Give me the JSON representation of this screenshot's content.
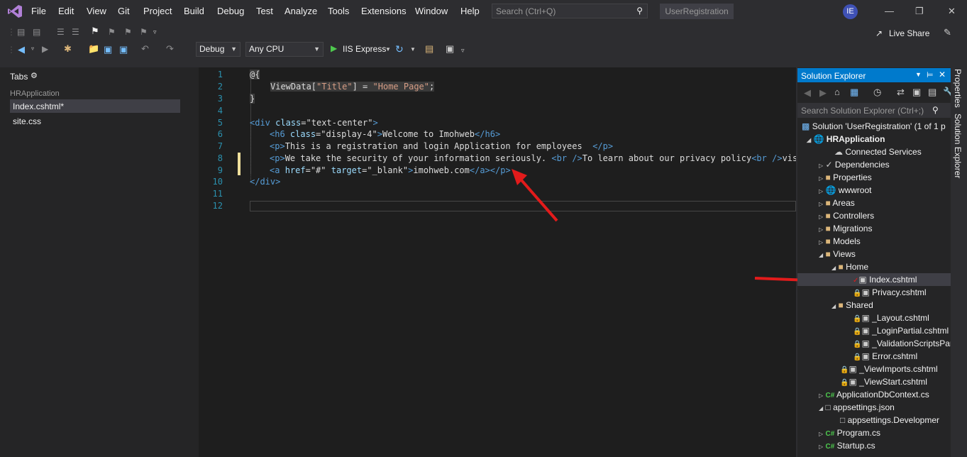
{
  "menu": [
    "File",
    "Edit",
    "View",
    "Git",
    "Project",
    "Build",
    "Debug",
    "Test",
    "Analyze",
    "Tools",
    "Extensions",
    "Window",
    "Help"
  ],
  "search": {
    "placeholder": "Search (Ctrl+Q)"
  },
  "solution_name": "UserRegistration",
  "user_initials": "IE",
  "live_share": "Live Share",
  "toolbar": {
    "config": "Debug",
    "platform": "Any CPU",
    "run_label": "IIS Express"
  },
  "tabs_panel": {
    "title": "Tabs",
    "group": "HRApplication",
    "files": [
      "Index.cshtml*",
      "site.css"
    ]
  },
  "editor": {
    "line_numbers": [
      "1",
      "2",
      "3",
      "4",
      "5",
      "6",
      "7",
      "8",
      "9",
      "10",
      "11",
      "12"
    ]
  },
  "solution_explorer": {
    "title": "Solution Explorer",
    "search_placeholder": "Search Solution Explorer (Ctrl+;)",
    "items": [
      "Solution 'UserRegistration' (1 of 1 p",
      "HRApplication",
      "Connected Services",
      "Dependencies",
      "Properties",
      "wwwroot",
      "Areas",
      "Controllers",
      "Migrations",
      "Models",
      "Views",
      "Home",
      "Index.cshtml",
      "Privacy.cshtml",
      "Shared",
      "_Layout.cshtml",
      "_LoginPartial.cshtml",
      "_ValidationScriptsPar",
      "Error.cshtml",
      "_ViewImports.cshtml",
      "_ViewStart.cshtml",
      "ApplicationDbContext.cs",
      "appsettings.json",
      "appsettings.Developmer",
      "Program.cs",
      "Startup.cs"
    ]
  },
  "side_tabs": [
    "Properties",
    "Solution Explorer"
  ]
}
